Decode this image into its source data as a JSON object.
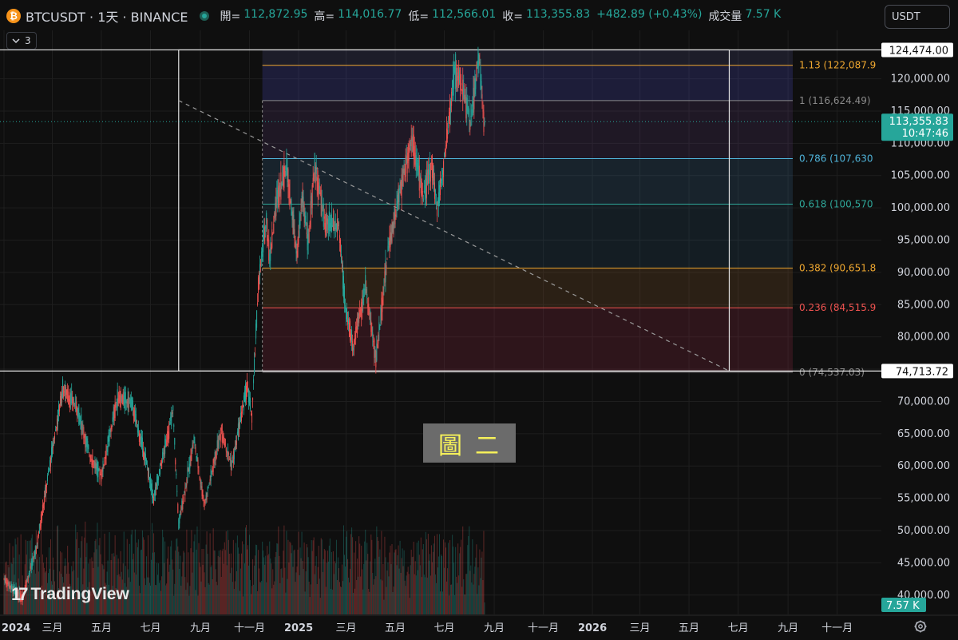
{
  "header": {
    "symbol_icon": "bitcoin-icon",
    "symbol_icon_glyph": "₿",
    "title": "BTCUSDT · 1天 · BINANCE",
    "open_label": "開=",
    "open": "112,872.95",
    "high_label": "高=",
    "high": "114,016.77",
    "low_label": "低=",
    "low": "112,566.01",
    "close_label": "收=",
    "close": "113,355.83",
    "change": "+482.89 (+0.43%)",
    "volume_label": "成交量",
    "volume": "7.57 K"
  },
  "collapse": {
    "count": "3",
    "icon": "chevron-down-icon"
  },
  "currency": {
    "label": "USDT",
    "icon": "chevron-down-icon"
  },
  "watermark": {
    "text": "TradingView"
  },
  "stamp": {
    "text": "圖二"
  },
  "colors": {
    "up": "#26a69a",
    "down": "#ef5350",
    "bg": "#0f0f0f",
    "grid": "#1e1e1e"
  },
  "chart_data": {
    "type": "candlestick",
    "symbol": "BTCUSDT",
    "interval": "1D",
    "exchange": "BINANCE",
    "ylim": [
      37000,
      127500
    ],
    "y_ticks": [
      40000,
      45000,
      50000,
      55000,
      60000,
      65000,
      70000,
      75000,
      80000,
      85000,
      90000,
      95000,
      100000,
      105000,
      110000,
      115000,
      120000
    ],
    "y_tick_labels": [
      "40,000.00",
      "45,000.00",
      "50,000.00",
      "55,000.00",
      "60,000.00",
      "65,000.00",
      "70,000.00",
      "75,000.00",
      "80,000.00",
      "85,000.00",
      "90,000.00",
      "95,000.00",
      "100,000.00",
      "105,000.00",
      "110,000.00",
      "115,000.00",
      "120,000.00"
    ],
    "x_range": [
      "2024-01-01",
      "2026-12-20"
    ],
    "x_ticks": [
      {
        "date": "2024-01-01",
        "label": "2024"
      },
      {
        "date": "2024-03-01",
        "label": "三月"
      },
      {
        "date": "2024-05-01",
        "label": "五月"
      },
      {
        "date": "2024-07-01",
        "label": "七月"
      },
      {
        "date": "2024-09-01",
        "label": "九月"
      },
      {
        "date": "2024-11-01",
        "label": "十一月"
      },
      {
        "date": "2025-01-01",
        "label": "2025"
      },
      {
        "date": "2025-03-01",
        "label": "三月"
      },
      {
        "date": "2025-05-01",
        "label": "五月"
      },
      {
        "date": "2025-07-01",
        "label": "七月"
      },
      {
        "date": "2025-09-01",
        "label": "九月"
      },
      {
        "date": "2025-11-01",
        "label": "十一月"
      },
      {
        "date": "2026-01-01",
        "label": "2026"
      },
      {
        "date": "2026-03-01",
        "label": "三月"
      },
      {
        "date": "2026-05-01",
        "label": "五月"
      },
      {
        "date": "2026-07-01",
        "label": "七月"
      },
      {
        "date": "2026-09-01",
        "label": "九月"
      },
      {
        "date": "2026-11-01",
        "label": "十一月"
      }
    ],
    "price_path": [
      {
        "date": "2024-01-01",
        "close": 42500
      },
      {
        "date": "2024-01-23",
        "close": 39500
      },
      {
        "date": "2024-02-10",
        "close": 47000
      },
      {
        "date": "2024-02-28",
        "close": 61000
      },
      {
        "date": "2024-03-14",
        "close": 72000
      },
      {
        "date": "2024-04-01",
        "close": 69000
      },
      {
        "date": "2024-04-17",
        "close": 61500
      },
      {
        "date": "2024-05-01",
        "close": 58500
      },
      {
        "date": "2024-05-21",
        "close": 70500
      },
      {
        "date": "2024-06-07",
        "close": 70000
      },
      {
        "date": "2024-06-25",
        "close": 61000
      },
      {
        "date": "2024-07-05",
        "close": 55000
      },
      {
        "date": "2024-07-29",
        "close": 68500
      },
      {
        "date": "2024-08-05",
        "close": 51000
      },
      {
        "date": "2024-08-24",
        "close": 64000
      },
      {
        "date": "2024-09-06",
        "close": 54000
      },
      {
        "date": "2024-09-27",
        "close": 65500
      },
      {
        "date": "2024-10-10",
        "close": 60000
      },
      {
        "date": "2024-10-29",
        "close": 72500
      },
      {
        "date": "2024-11-04",
        "close": 67500
      },
      {
        "date": "2024-11-12",
        "close": 88000
      },
      {
        "date": "2024-11-22",
        "close": 98500
      },
      {
        "date": "2024-11-26",
        "close": 92000
      },
      {
        "date": "2024-12-05",
        "close": 101500
      },
      {
        "date": "2024-12-17",
        "close": 106500
      },
      {
        "date": "2024-12-30",
        "close": 92500
      },
      {
        "date": "2025-01-06",
        "close": 102000
      },
      {
        "date": "2025-01-13",
        "close": 94500
      },
      {
        "date": "2025-01-21",
        "close": 106500
      },
      {
        "date": "2025-02-03",
        "close": 97500
      },
      {
        "date": "2025-02-20",
        "close": 97000
      },
      {
        "date": "2025-02-28",
        "close": 84500
      },
      {
        "date": "2025-03-10",
        "close": 78500
      },
      {
        "date": "2025-03-25",
        "close": 88000
      },
      {
        "date": "2025-04-07",
        "close": 76500
      },
      {
        "date": "2025-04-22",
        "close": 93500
      },
      {
        "date": "2025-05-08",
        "close": 103000
      },
      {
        "date": "2025-05-22",
        "close": 111000
      },
      {
        "date": "2025-06-05",
        "close": 101500
      },
      {
        "date": "2025-06-16",
        "close": 107000
      },
      {
        "date": "2025-06-22",
        "close": 99500
      },
      {
        "date": "2025-07-03",
        "close": 109500
      },
      {
        "date": "2025-07-14",
        "close": 121500
      },
      {
        "date": "2025-07-24",
        "close": 118500
      },
      {
        "date": "2025-08-02",
        "close": 113000
      },
      {
        "date": "2025-08-13",
        "close": 123500
      },
      {
        "date": "2025-08-18",
        "close": 115000
      },
      {
        "date": "2025-08-20",
        "close": 113355.83
      }
    ],
    "volume_max_k": 60,
    "fib_retracement": {
      "start_date": "2024-11-17",
      "end_date": "2026-06-20",
      "levels": [
        {
          "ratio": "1.13",
          "price": 122087.9,
          "label": "1.13 (122,087.9",
          "color": "#f0a830"
        },
        {
          "ratio": "1",
          "price": 116624.49,
          "label": "1 (116,624.49)",
          "color": "#8a8a8a"
        },
        {
          "ratio": "0.786",
          "price": 107630,
          "label": "0.786 (107,630",
          "color": "#4fb3d9"
        },
        {
          "ratio": "0.618",
          "price": 100570,
          "label": "0.618 (100,570",
          "color": "#2fa89a"
        },
        {
          "ratio": "0.382",
          "price": 90651.8,
          "label": "0.382 (90,651.8",
          "color": "#f0a830"
        },
        {
          "ratio": "0.236",
          "price": 84515.9,
          "label": "0.236 (84,515.9",
          "color": "#ef5350"
        },
        {
          "ratio": "0",
          "price": 74537.03,
          "label": "0 (74,537.03)",
          "color": "#8a8a8a"
        }
      ]
    },
    "trend_line": {
      "from": {
        "date": "2024-08-05",
        "price": 116624.49
      },
      "to": {
        "date": "2026-06-20",
        "price": 74713.72
      }
    },
    "horizontal_lines": [
      {
        "price": 124474.0,
        "label": "124,474.00"
      },
      {
        "price": 74713.72,
        "label": "74,713.72"
      }
    ],
    "last_price": {
      "price": 113355.83,
      "label": "113,355.83",
      "countdown": "10:47:46"
    },
    "volume_badge": "7.57 K"
  }
}
